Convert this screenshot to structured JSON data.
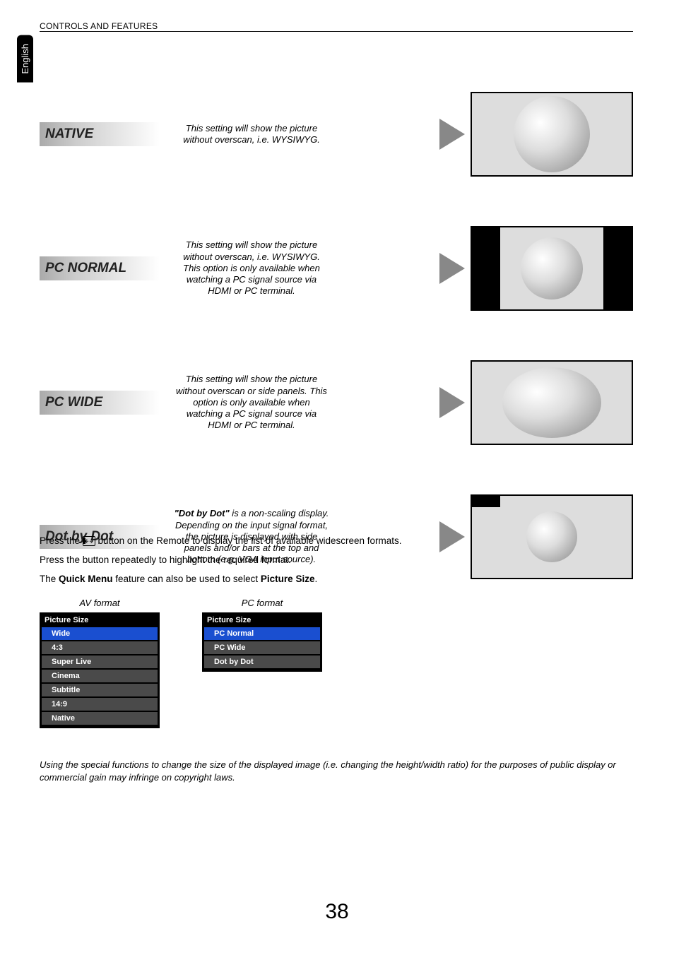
{
  "language_tab": "English",
  "section_header": "CONTROLS AND FEATURES",
  "modes": [
    {
      "key": "native",
      "label": "NATIVE",
      "desc": "This setting will show the picture without overscan, i.e. WYSIWYG."
    },
    {
      "key": "pc_normal",
      "label": "PC NORMAL",
      "desc": "This setting will show the picture without overscan, i.e. WYSIWYG. This option is only available when watching a PC signal source via HDMI or PC terminal."
    },
    {
      "key": "pc_wide",
      "label": "PC WIDE",
      "desc": "This setting will show the picture without overscan or side panels. This option is only available when watching a PC signal source via HDMI or PC terminal."
    },
    {
      "key": "dot_by_dot",
      "label": "Dot by Dot",
      "desc_prefix": "\"Dot by Dot\"",
      "desc_rest": " is a non-scaling display. Depending on the input signal format, the picture is displayed with side panels and/or bars at the top and bottom (e.g. VGA input source)."
    }
  ],
  "instructions": {
    "line1_a": "Press the ",
    "line1_b": " button on the Remote to display the list of available widescreen formats.",
    "line2": "Press the button repeatedly to highlight the required format.",
    "line3_a": "The ",
    "line3_b": "Quick Menu",
    "line3_c": " feature can also be used to select ",
    "line3_d": "Picture Size",
    "line3_e": "."
  },
  "menu_av": {
    "caption": "AV format",
    "header": "Picture Size",
    "items": [
      "Wide",
      "4:3",
      "Super Live",
      "Cinema",
      "Subtitle",
      "14:9",
      "Native"
    ],
    "selected_index": 0
  },
  "menu_pc": {
    "caption": "PC format",
    "header": "Picture Size",
    "items": [
      "PC Normal",
      "PC Wide",
      "Dot by Dot"
    ],
    "selected_index": 0
  },
  "footnote": "Using the special functions to change the size of the displayed image (i.e. changing the height/width ratio) for the purposes of public display or commercial gain may infringe on copyright laws.",
  "page_number": "38"
}
